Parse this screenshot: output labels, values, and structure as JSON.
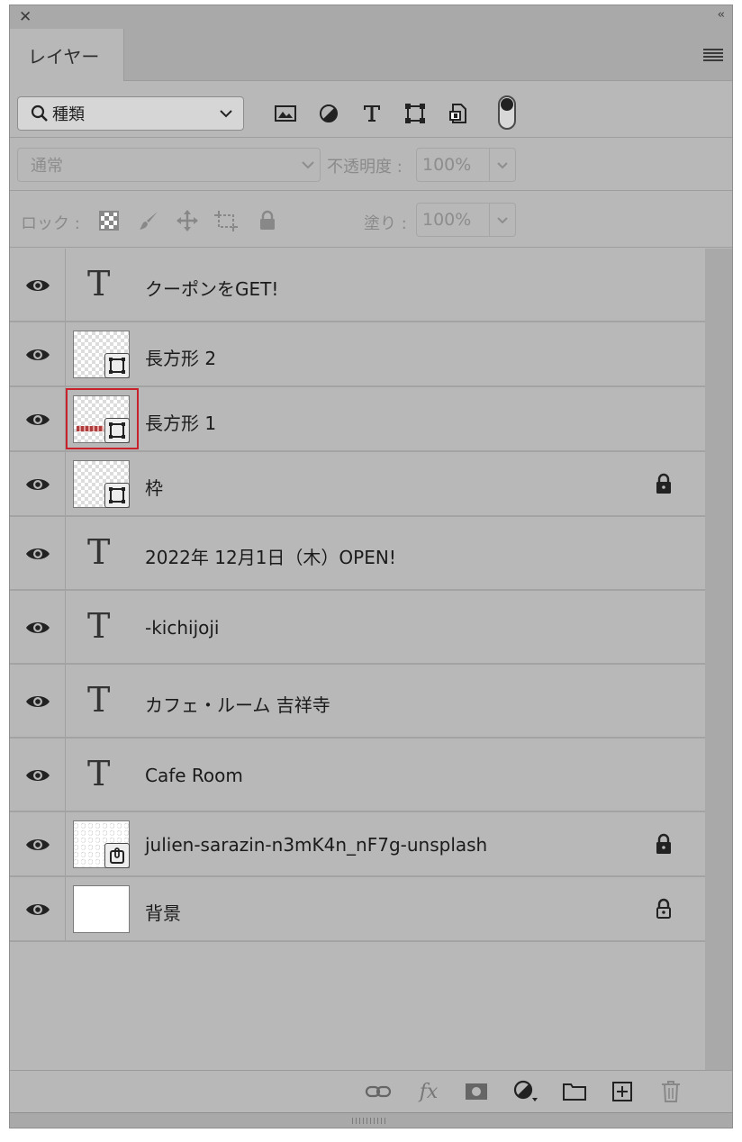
{
  "panel": {
    "close_glyph": "✕",
    "collapse_glyph": "‹‹",
    "tab_label": "レイヤー"
  },
  "filter": {
    "kind_label": "種類",
    "icons": [
      "image-filter-icon",
      "adjustment-filter-icon",
      "type-filter-icon",
      "shape-filter-icon",
      "smart-object-filter-icon"
    ]
  },
  "blend": {
    "mode": "通常",
    "opacity_label": "不透明度 :",
    "opacity_value": "100%",
    "fill_label": "塗り :",
    "fill_value": "100%"
  },
  "lock": {
    "label": "ロック :"
  },
  "layers": [
    {
      "name": "クーポンをGET!",
      "kind": "text",
      "locked": false
    },
    {
      "name": "長方形 2",
      "kind": "shape",
      "locked": false
    },
    {
      "name": "長方形 1",
      "kind": "shape",
      "locked": false,
      "selected_thumb": true
    },
    {
      "name": "枠",
      "kind": "shape",
      "locked": true
    },
    {
      "name": "2022年 12月1日（木）OPEN!",
      "kind": "text",
      "locked": false
    },
    {
      "name": "-kichijoji",
      "kind": "text",
      "locked": false
    },
    {
      "name": "カフェ・ルーム 吉祥寺",
      "kind": "text",
      "locked": false
    },
    {
      "name": "Cafe Room",
      "kind": "text",
      "locked": false
    },
    {
      "name": "julien-sarazin-n3mK4n_nF7g-unsplash",
      "kind": "smart",
      "locked": true
    },
    {
      "name": "背景",
      "kind": "background",
      "locked": true
    }
  ],
  "bottombar": {
    "fx_label": "fx"
  },
  "colors": {
    "panel_bg": "#b8b8b8",
    "selection_border": "#c8232c"
  }
}
